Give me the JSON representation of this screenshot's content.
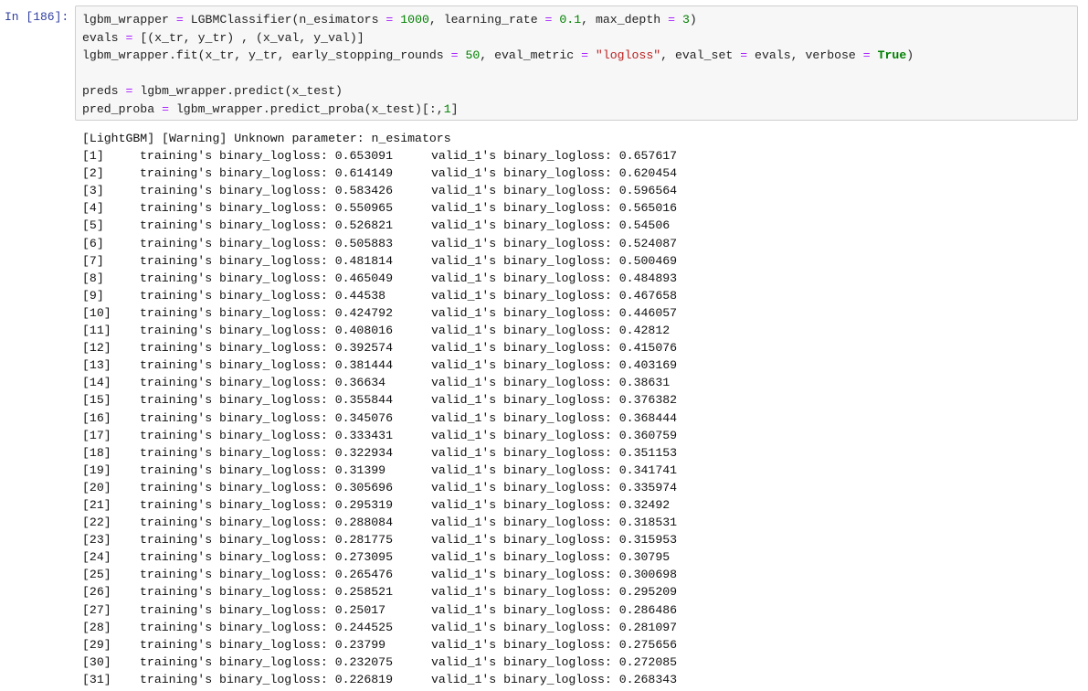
{
  "cell": {
    "prompt": "In [186]:",
    "code_lines": [
      [
        [
          "lgbm_wrapper ",
          "t"
        ],
        [
          "=",
          "op"
        ],
        [
          " LGBMClassifier(n_esimators ",
          "t"
        ],
        [
          "=",
          "op"
        ],
        [
          " ",
          "t"
        ],
        [
          "1000",
          "num"
        ],
        [
          ", learning_rate ",
          "t"
        ],
        [
          "=",
          "op"
        ],
        [
          " ",
          "t"
        ],
        [
          "0.1",
          "num"
        ],
        [
          ", max_depth ",
          "t"
        ],
        [
          "=",
          "op"
        ],
        [
          " ",
          "t"
        ],
        [
          "3",
          "num"
        ],
        [
          ")",
          "t"
        ]
      ],
      [
        [
          "evals ",
          "t"
        ],
        [
          "=",
          "op"
        ],
        [
          " [(x_tr, y_tr) , (x_val, y_val)]",
          "t"
        ]
      ],
      [
        [
          "lgbm_wrapper.fit(x_tr, y_tr, early_stopping_rounds ",
          "t"
        ],
        [
          "=",
          "op"
        ],
        [
          " ",
          "t"
        ],
        [
          "50",
          "num"
        ],
        [
          ", eval_metric ",
          "t"
        ],
        [
          "=",
          "op"
        ],
        [
          " ",
          "t"
        ],
        [
          "\"logloss\"",
          "str"
        ],
        [
          ", eval_set ",
          "t"
        ],
        [
          "=",
          "op"
        ],
        [
          " evals, verbose ",
          "t"
        ],
        [
          "=",
          "op"
        ],
        [
          " ",
          "t"
        ],
        [
          "True",
          "kw"
        ],
        [
          ")",
          "t"
        ]
      ],
      [],
      [
        [
          "preds ",
          "t"
        ],
        [
          "=",
          "op"
        ],
        [
          " lgbm_wrapper.predict(x_test)",
          "t"
        ]
      ],
      [
        [
          "pred_proba ",
          "t"
        ],
        [
          "=",
          "op"
        ],
        [
          " lgbm_wrapper.predict_proba(x_test)[:,",
          "t"
        ],
        [
          "1",
          "num"
        ],
        [
          "]",
          "t"
        ]
      ]
    ]
  },
  "output": {
    "warning": "[LightGBM] [Warning] Unknown parameter: n_esimators",
    "train_label": "training's binary_logloss: ",
    "valid_label": "valid_1's binary_logloss: ",
    "rows": [
      [
        "[1]",
        "0.653091",
        "0.657617"
      ],
      [
        "[2]",
        "0.614149",
        "0.620454"
      ],
      [
        "[3]",
        "0.583426",
        "0.596564"
      ],
      [
        "[4]",
        "0.550965",
        "0.565016"
      ],
      [
        "[5]",
        "0.526821",
        "0.54506"
      ],
      [
        "[6]",
        "0.505883",
        "0.524087"
      ],
      [
        "[7]",
        "0.481814",
        "0.500469"
      ],
      [
        "[8]",
        "0.465049",
        "0.484893"
      ],
      [
        "[9]",
        "0.44538",
        "0.467658"
      ],
      [
        "[10]",
        "0.424792",
        "0.446057"
      ],
      [
        "[11]",
        "0.408016",
        "0.42812"
      ],
      [
        "[12]",
        "0.392574",
        "0.415076"
      ],
      [
        "[13]",
        "0.381444",
        "0.403169"
      ],
      [
        "[14]",
        "0.36634",
        "0.38631"
      ],
      [
        "[15]",
        "0.355844",
        "0.376382"
      ],
      [
        "[16]",
        "0.345076",
        "0.368444"
      ],
      [
        "[17]",
        "0.333431",
        "0.360759"
      ],
      [
        "[18]",
        "0.322934",
        "0.351153"
      ],
      [
        "[19]",
        "0.31399",
        "0.341741"
      ],
      [
        "[20]",
        "0.305696",
        "0.335974"
      ],
      [
        "[21]",
        "0.295319",
        "0.32492"
      ],
      [
        "[22]",
        "0.288084",
        "0.318531"
      ],
      [
        "[23]",
        "0.281775",
        "0.315953"
      ],
      [
        "[24]",
        "0.273095",
        "0.30795"
      ],
      [
        "[25]",
        "0.265476",
        "0.300698"
      ],
      [
        "[26]",
        "0.258521",
        "0.295209"
      ],
      [
        "[27]",
        "0.25017",
        "0.286486"
      ],
      [
        "[28]",
        "0.244525",
        "0.281097"
      ],
      [
        "[29]",
        "0.23799",
        "0.275656"
      ],
      [
        "[30]",
        "0.232075",
        "0.272085"
      ],
      [
        "[31]",
        "0.226819",
        "0.268343"
      ]
    ]
  }
}
